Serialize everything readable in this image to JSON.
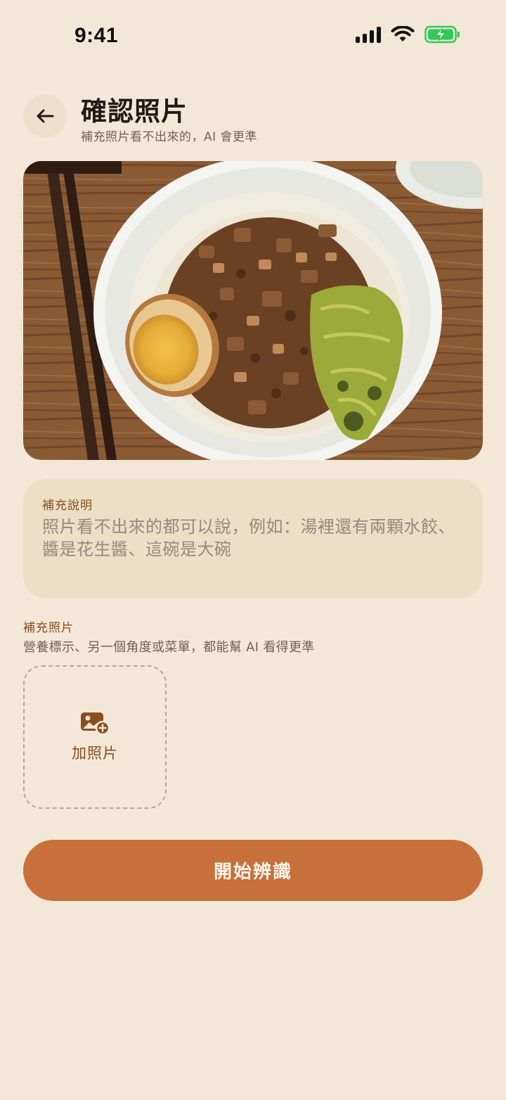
{
  "status_bar": {
    "time": "9:41",
    "icons": [
      "cellular-signal-icon",
      "wifi-icon",
      "battery-charging-icon"
    ],
    "battery_color": "#34c759"
  },
  "header": {
    "back_icon": "arrow-left-icon",
    "title": "確認照片",
    "subtitle": "補充照片看不出來的，AI 會更準"
  },
  "photo": {
    "content": "滷肉飯 with braised egg and pickled mustard greens"
  },
  "notes": {
    "label": "補充說明",
    "placeholder": "照片看不出來的都可以說，例如：湯裡還有兩顆水餃、醬是花生醬、這碗是大碗"
  },
  "extra_photos": {
    "title": "補充照片",
    "description": "營養標示、另一個角度或菜單，都能幫 AI 看得更準",
    "add_label": "加照片",
    "add_icon": "add-photo-icon"
  },
  "primary_action": {
    "label": "開始辨識"
  },
  "colors": {
    "background": "#f3e8d8",
    "accent": "#c7703a",
    "label_brown": "#8a4d1f",
    "card": "#ebdfc6"
  }
}
